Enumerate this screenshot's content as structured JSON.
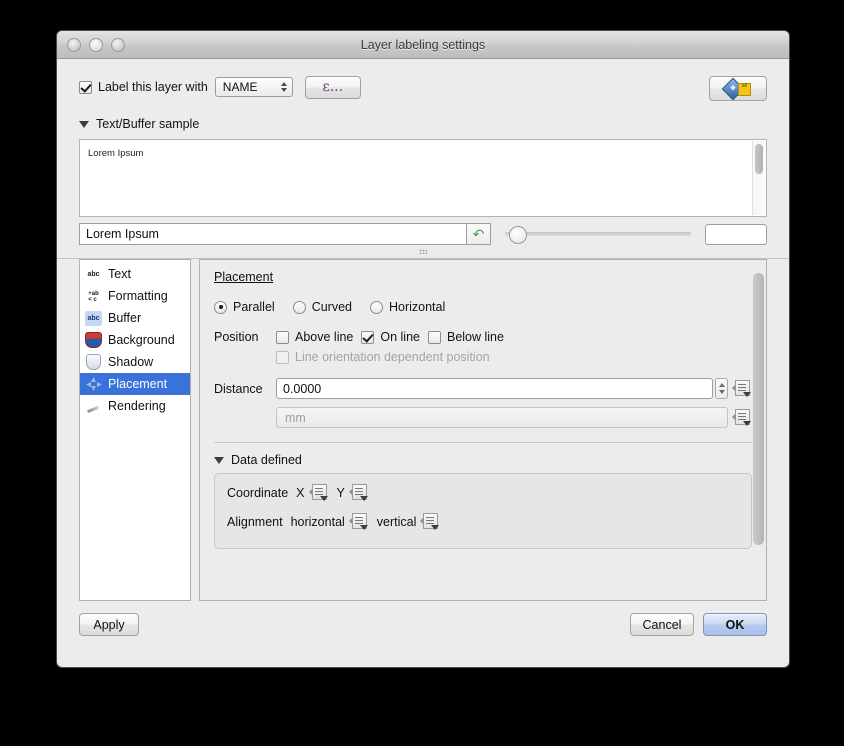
{
  "window": {
    "title": "Layer labeling settings",
    "traffic_lights": [
      "close",
      "minimize",
      "zoom"
    ]
  },
  "header": {
    "checkbox_checked": true,
    "label": "Label this layer with",
    "field_combo_value": "NAME",
    "expression_button_label": "ε...",
    "toolbar_button_icon": "labeling-placement-icon"
  },
  "sample_group": {
    "header": "Text/Buffer sample",
    "preview_text": "Lorem Ipsum",
    "input_value": "Lorem Ipsum",
    "reset_icon": "revert-arrow-icon",
    "zoom_value": "",
    "scale_field_value": ""
  },
  "sidebar": {
    "items": [
      {
        "label": "Text",
        "icon": "text-abc-icon",
        "selected": false
      },
      {
        "label": "Formatting",
        "icon": "formatting-icon",
        "selected": false
      },
      {
        "label": "Buffer",
        "icon": "buffer-abc-icon",
        "selected": false
      },
      {
        "label": "Background",
        "icon": "background-shield-icon",
        "selected": false
      },
      {
        "label": "Shadow",
        "icon": "shadow-shield-icon",
        "selected": false
      },
      {
        "label": "Placement",
        "icon": "placement-arrows-icon",
        "selected": true
      },
      {
        "label": "Rendering",
        "icon": "rendering-brush-icon",
        "selected": false
      }
    ],
    "selection_color": "#3b72d9"
  },
  "panel": {
    "title": "Placement",
    "modes": [
      {
        "label": "Parallel",
        "selected": true
      },
      {
        "label": "Curved",
        "selected": false
      },
      {
        "label": "Horizontal",
        "selected": false
      }
    ],
    "position_label": "Position",
    "position_options": [
      {
        "label": "Above line",
        "checked": false
      },
      {
        "label": "On line",
        "checked": true
      },
      {
        "label": "Below line",
        "checked": false
      }
    ],
    "line_orientation": {
      "label": "Line orientation dependent position",
      "checked": false,
      "enabled": false
    },
    "distance": {
      "label": "Distance",
      "value": "0.0000",
      "units_value": "mm",
      "units_enabled": false,
      "override_icon": "data-defined-override-icon"
    },
    "data_defined": {
      "header": "Data defined",
      "rows": [
        {
          "label": "Coordinate",
          "fields": [
            {
              "name": "X",
              "override_icon": "data-defined-override-icon"
            },
            {
              "name": "Y",
              "override_icon": "data-defined-override-icon"
            }
          ]
        },
        {
          "label": "Alignment",
          "fields": [
            {
              "name": "horizontal",
              "override_icon": "data-defined-override-icon"
            },
            {
              "name": "vertical",
              "override_icon": "data-defined-override-icon"
            }
          ]
        }
      ]
    }
  },
  "footer": {
    "apply_label": "Apply",
    "cancel_label": "Cancel",
    "ok_label": "OK"
  }
}
